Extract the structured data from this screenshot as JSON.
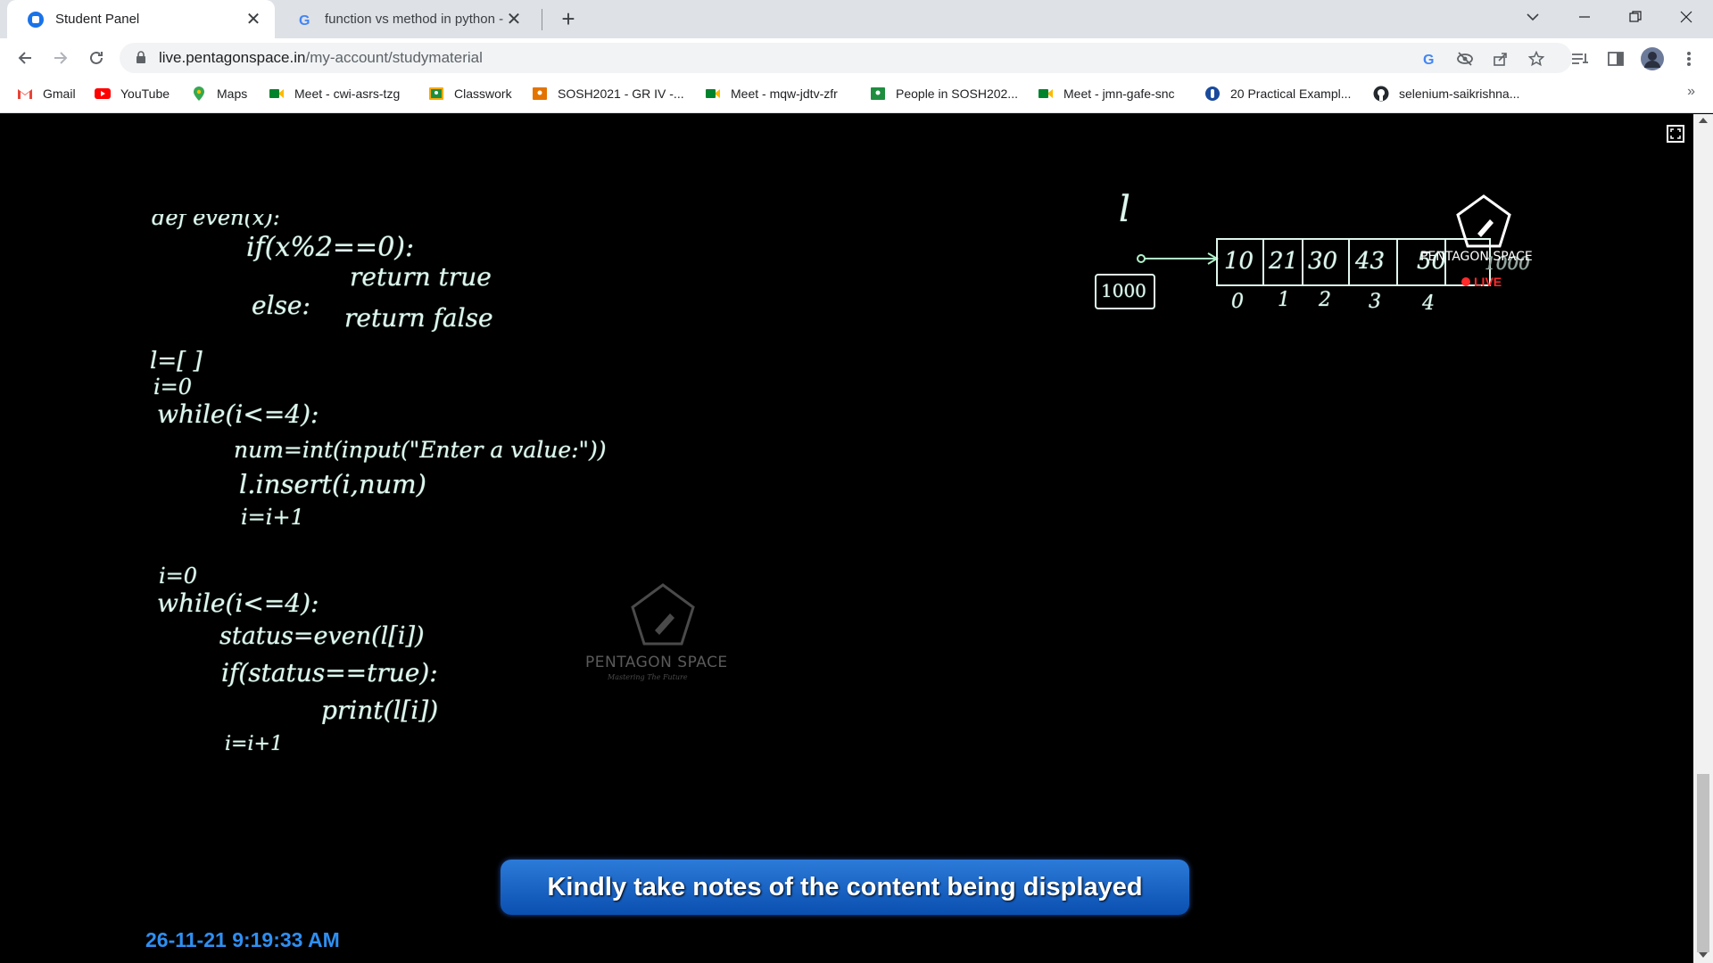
{
  "browser": {
    "tabs": [
      {
        "title": "Student Panel",
        "active": true
      },
      {
        "title": "function vs method in python - G",
        "active": false
      }
    ],
    "new_tab_symbol": "+",
    "close_symbol": "✕",
    "window_controls": [
      "chevron-down-icon",
      "minimize-icon",
      "restore-icon",
      "close-icon"
    ],
    "url_host": "live.pentagonspace.in",
    "url_path": "/my-account/studymaterial",
    "bookmarks": [
      {
        "label": "Gmail",
        "icon": "gmail-icon"
      },
      {
        "label": "YouTube",
        "icon": "youtube-icon"
      },
      {
        "label": "Maps",
        "icon": "maps-icon"
      },
      {
        "label": "Meet - cwi-asrs-tzg",
        "icon": "meet-icon"
      },
      {
        "label": "Classwork",
        "icon": "classroom-icon"
      },
      {
        "label": "SOSH2021 - GR IV -...",
        "icon": "classroom-icon"
      },
      {
        "label": "Meet - mqw-jdtv-zfr",
        "icon": "meet-icon"
      },
      {
        "label": "People in SOSH202...",
        "icon": "classroom-icon"
      },
      {
        "label": "Meet - jmn-gafe-snc",
        "icon": "meet-icon"
      },
      {
        "label": "20 Practical Exampl...",
        "icon": "site-icon"
      },
      {
        "label": "selenium-saikrishna...",
        "icon": "github-icon"
      }
    ],
    "bookmarks_overflow": "»"
  },
  "video": {
    "code_lines": [
      "def even(x):",
      "if(x%2==0):",
      "return true",
      "else:",
      "return false",
      "l=[ ]",
      "i=0",
      "while(i<=4):",
      "num=int(input(\"Enter a value:\"))",
      "l.insert(i,num)",
      "i=i+1",
      "i=0",
      "while(i<=4):",
      "status=even(l[i])",
      "if(status==true):",
      "print(l[i])",
      "i=i+1"
    ],
    "diagram": {
      "var_label": "l",
      "address": "1000",
      "cells": [
        "10",
        "21",
        "30",
        "43",
        "50",
        "1000"
      ],
      "indices": [
        "0",
        "1",
        "2",
        "3",
        "4"
      ]
    },
    "logo_name": "PENTAGON SPACE",
    "logo_tagline": "Mastering The Future",
    "live_label": "LIVE",
    "banner": "Kindly take notes of the content being displayed",
    "timestamp": "26-11-21 9:19:33 AM"
  }
}
